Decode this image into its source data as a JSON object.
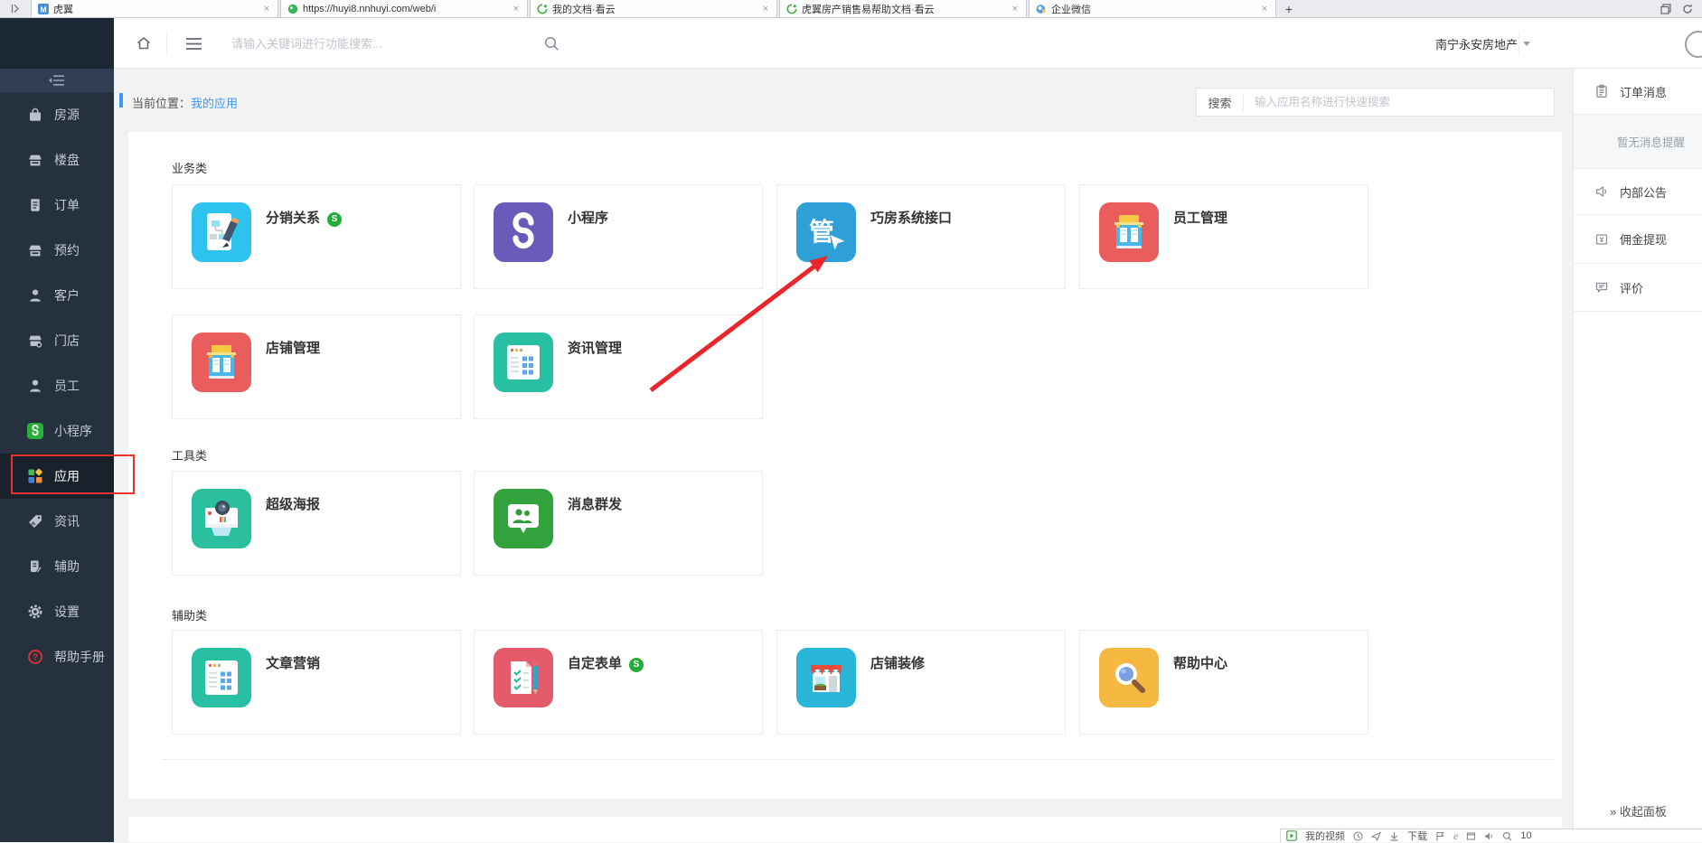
{
  "tabbar": {
    "tabs": [
      {
        "title": "虎翼"
      },
      {
        "title": "https://huyi8.nnhuyi.com/web/i"
      },
      {
        "title": "我的文档·看云"
      },
      {
        "title": "虎翼房产销售易帮助文档·看云"
      },
      {
        "title": "企业微信"
      }
    ],
    "close_glyph": "×",
    "new_tab_glyph": "+"
  },
  "header": {
    "search_placeholder": "请输入关键词进行功能搜索...",
    "company_name": "南宁永安房地产"
  },
  "breadcrumb": {
    "label": "当前位置：",
    "current": "我的应用"
  },
  "panel_search": {
    "button_label": "搜索",
    "placeholder": "输入应用名称进行快速搜索"
  },
  "sidebar": {
    "items": [
      {
        "label": "房源"
      },
      {
        "label": "楼盘"
      },
      {
        "label": "订单"
      },
      {
        "label": "预约"
      },
      {
        "label": "客户"
      },
      {
        "label": "门店"
      },
      {
        "label": "员工"
      },
      {
        "label": "小程序"
      },
      {
        "label": "应用"
      },
      {
        "label": "资讯"
      },
      {
        "label": "辅助"
      },
      {
        "label": "设置"
      },
      {
        "label": "帮助手册"
      }
    ]
  },
  "sections": [
    {
      "title": "业务类",
      "apps": [
        {
          "name": "分销关系"
        },
        {
          "name": "小程序"
        },
        {
          "name": "巧房系统接口"
        },
        {
          "name": "员工管理"
        },
        {
          "name": "店铺管理"
        },
        {
          "name": "资讯管理"
        }
      ]
    },
    {
      "title": "工具类",
      "apps": [
        {
          "name": "超级海报"
        },
        {
          "name": "消息群发"
        }
      ]
    },
    {
      "title": "辅助类",
      "apps": [
        {
          "name": "文章营销"
        },
        {
          "name": "自定表单"
        },
        {
          "name": "店铺装修"
        },
        {
          "name": "帮助中心"
        }
      ]
    }
  ],
  "icon_glyphs": {
    "qiaofang": "管",
    "tab_m": "M",
    "mp_badge": "S",
    "ie": "e"
  },
  "right_panel": {
    "items": [
      {
        "label": "订单消息"
      },
      {
        "label": "内部公告"
      },
      {
        "label": "佣金提现"
      },
      {
        "label": "评价"
      }
    ],
    "empty_text": "暂无消息提醒",
    "collapse_chevron": "»",
    "collapse_label": "收起面板"
  },
  "status_bar": {
    "video_label": "我的视频",
    "download_label": "下载",
    "zoom_text": "10"
  },
  "colors": {
    "accent_blue": "#3e97f0",
    "annotation_red": "#e8332d",
    "badge_green": "#23ac38"
  }
}
